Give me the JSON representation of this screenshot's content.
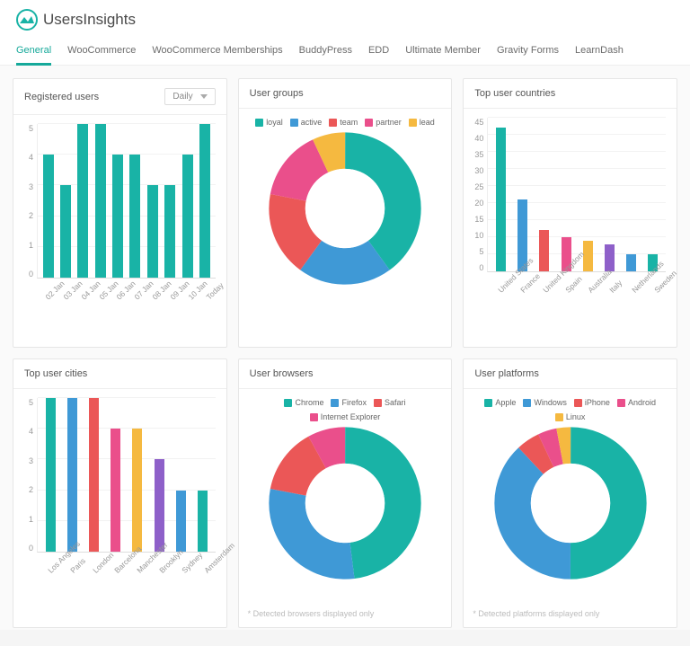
{
  "brand": {
    "name": "UsersInsights"
  },
  "tabs": [
    "General",
    "WooCommerce",
    "WooCommerce Memberships",
    "BuddyPress",
    "EDD",
    "Ultimate Member",
    "Gravity Forms",
    "LearnDash"
  ],
  "active_tab": 0,
  "palette": {
    "teal": "#19b3a6",
    "blue": "#3f99d6",
    "red": "#eb5757",
    "pink": "#ea4f8b",
    "amber": "#f5b940",
    "purple": "#8e60c9"
  },
  "cards": {
    "registered": {
      "title": "Registered users",
      "selector": {
        "value": "Daily"
      }
    },
    "groups": {
      "title": "User groups"
    },
    "countries": {
      "title": "Top user countries"
    },
    "cities": {
      "title": "Top user cities"
    },
    "browsers": {
      "title": "User browsers",
      "footnote": "* Detected browsers displayed only"
    },
    "platforms": {
      "title": "User platforms",
      "footnote": "* Detected platforms displayed only"
    }
  },
  "chart_data": [
    {
      "id": "registered",
      "type": "bar",
      "title": "Registered users",
      "ylim": [
        0,
        5
      ],
      "yticks": [
        0,
        1,
        2,
        3,
        4,
        5
      ],
      "categories": [
        "02 Jan",
        "03 Jan",
        "04 Jan",
        "05 Jan",
        "06 Jan",
        "07 Jan",
        "08 Jan",
        "09 Jan",
        "10 Jan",
        "Today"
      ],
      "values": [
        4,
        3,
        5,
        5,
        4,
        4,
        3,
        3,
        4,
        5
      ],
      "colors": [
        "#19b3a6"
      ]
    },
    {
      "id": "groups",
      "type": "donut",
      "title": "User groups",
      "series": [
        {
          "name": "loyal",
          "value": 40,
          "color": "#19b3a6"
        },
        {
          "name": "active",
          "value": 20,
          "color": "#3f99d6"
        },
        {
          "name": "team",
          "value": 18,
          "color": "#eb5757"
        },
        {
          "name": "partner",
          "value": 15,
          "color": "#ea4f8b"
        },
        {
          "name": "lead",
          "value": 7,
          "color": "#f5b940"
        }
      ]
    },
    {
      "id": "countries",
      "type": "bar",
      "title": "Top user countries",
      "ylim": [
        0,
        45
      ],
      "yticks": [
        0,
        5,
        10,
        15,
        20,
        25,
        30,
        35,
        40,
        45
      ],
      "categories": [
        "United States",
        "France",
        "United Kingdom",
        "Spain",
        "Australia",
        "Italy",
        "Netherlands",
        "Sweden"
      ],
      "values": [
        42,
        21,
        12,
        10,
        9,
        8,
        5,
        5
      ],
      "colors": [
        "#19b3a6",
        "#3f99d6",
        "#eb5757",
        "#ea4f8b",
        "#f5b940",
        "#8e60c9",
        "#3f99d6",
        "#19b3a6"
      ]
    },
    {
      "id": "cities",
      "type": "bar",
      "title": "Top user cities",
      "ylim": [
        0,
        5
      ],
      "yticks": [
        0,
        1,
        2,
        3,
        4,
        5
      ],
      "categories": [
        "Los Angeles",
        "Paris",
        "London",
        "Barcelona",
        "Manchester",
        "Brooklyn",
        "Sydney",
        "Amsterdam"
      ],
      "values": [
        5,
        5,
        5,
        4,
        4,
        3,
        2,
        2
      ],
      "colors": [
        "#19b3a6",
        "#3f99d6",
        "#eb5757",
        "#ea4f8b",
        "#f5b940",
        "#8e60c9",
        "#3f99d6",
        "#19b3a6"
      ]
    },
    {
      "id": "browsers",
      "type": "donut",
      "title": "User browsers",
      "series": [
        {
          "name": "Chrome",
          "value": 48,
          "color": "#19b3a6"
        },
        {
          "name": "Firefox",
          "value": 30,
          "color": "#3f99d6"
        },
        {
          "name": "Safari",
          "value": 14,
          "color": "#eb5757"
        },
        {
          "name": "Internet Explorer",
          "value": 8,
          "color": "#ea4f8b"
        }
      ]
    },
    {
      "id": "platforms",
      "type": "donut",
      "title": "User platforms",
      "series": [
        {
          "name": "Apple",
          "value": 50,
          "color": "#19b3a6"
        },
        {
          "name": "Windows",
          "value": 38,
          "color": "#3f99d6"
        },
        {
          "name": "iPhone",
          "value": 5,
          "color": "#eb5757"
        },
        {
          "name": "Android",
          "value": 4,
          "color": "#ea4f8b"
        },
        {
          "name": "Linux",
          "value": 3,
          "color": "#f5b940"
        }
      ]
    }
  ]
}
